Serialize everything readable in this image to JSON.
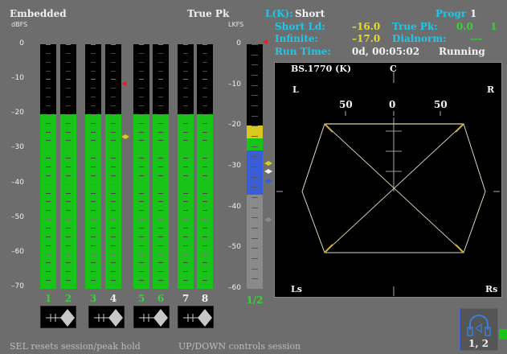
{
  "header": {
    "embedded_title": "Embedded",
    "dbfs_unit": "dBFS",
    "true_pk_title": "True Pk",
    "lkfs_unit": "LKFS"
  },
  "loudness": {
    "lk_label": "L(K):",
    "lk_value": "Short",
    "short_ld_label": "Short Ld:",
    "short_ld_value": "–16.0",
    "infinite_label": "Infinite:",
    "infinite_value": "–17.0",
    "run_time_label": "Run Time:",
    "run_time_value": "0d, 00:05:02",
    "status": "Running",
    "progr_label": "Progr",
    "progr_value": "1",
    "true_pk_label": "True Pk:",
    "true_pk_value": "0.0",
    "true_pk_count": "1",
    "dialnorm_label": "Dialnorm:",
    "dialnorm_value": "---"
  },
  "dbfs_scale": [
    "0",
    "–10",
    "–20",
    "–30",
    "–40",
    "–50",
    "–60",
    "–70"
  ],
  "lkfs_scale": [
    "0",
    "–10",
    "–20",
    "–30",
    "–40",
    "–50",
    "–60"
  ],
  "channels": [
    {
      "label": "1",
      "color": "#3ad23a",
      "level_db": -20
    },
    {
      "label": "2",
      "color": "#3ad23a",
      "level_db": -20
    },
    {
      "label": "3",
      "color": "#3ad23a",
      "level_db": -20
    },
    {
      "label": "4",
      "color": "#f4f4f4",
      "level_db": -20
    },
    {
      "label": "5",
      "color": "#3ad23a",
      "level_db": -20
    },
    {
      "label": "6",
      "color": "#3ad23a",
      "level_db": -20
    },
    {
      "label": "7",
      "color": "#f4f4f4",
      "level_db": -20
    },
    {
      "label": "8",
      "color": "#f4f4f4",
      "level_db": -20
    }
  ],
  "loudness_bar": {
    "label": "1/2",
    "segments": [
      {
        "name": "gray",
        "from_db": -60,
        "to_db": -37,
        "color": "#8a8a8a"
      },
      {
        "name": "blue",
        "from_db": -37,
        "to_db": -26,
        "color": "#3a5ed8"
      },
      {
        "name": "green",
        "from_db": -26,
        "to_db": -23,
        "color": "#18c418"
      },
      {
        "name": "yellow",
        "from_db": -23,
        "to_db": -20,
        "color": "#d8c820"
      }
    ]
  },
  "surround": {
    "title": "BS.1770 (K)",
    "center": "C",
    "left": "L",
    "right": "R",
    "left_surround": "Ls",
    "right_surround": "Rs",
    "scale_labels": [
      "50",
      "0",
      "50"
    ]
  },
  "headphones": {
    "channels": "1, 2"
  },
  "footer": {
    "sel_message": "SEL resets session/peak hold",
    "updown_message": "UP/DOWN controls session"
  }
}
